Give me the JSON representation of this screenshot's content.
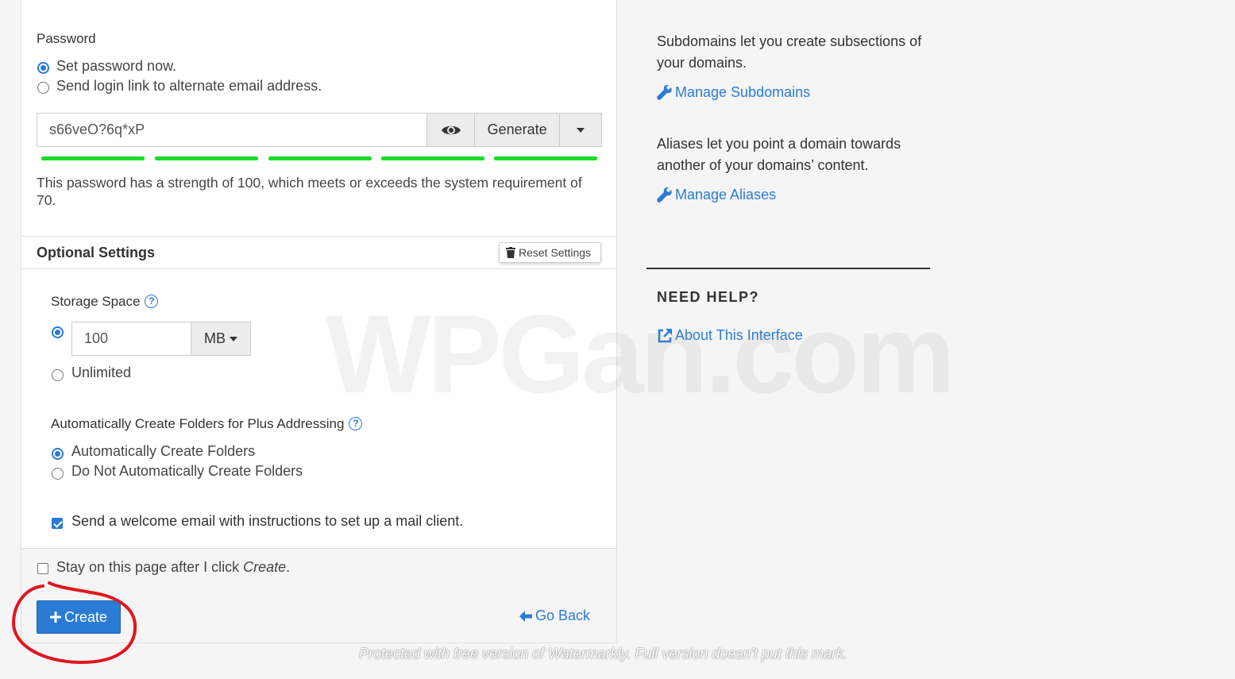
{
  "password": {
    "label": "Password",
    "options": [
      "Set password now.",
      "Send login link to alternate email address."
    ],
    "value": "s66veO?6q*xP",
    "generate_label": "Generate",
    "strength_segments": 5,
    "strength_text": "This password has a strength of 100, which meets or exceeds the system requirement of 70."
  },
  "optional_settings": {
    "title": "Optional Settings",
    "reset_label": "Reset Settings",
    "storage": {
      "label": "Storage Space",
      "value": "100",
      "unit": "MB",
      "unlimited_label": "Unlimited"
    },
    "plus_addressing": {
      "label": "Automatically Create Folders for Plus Addressing",
      "options": [
        "Automatically Create Folders",
        "Do Not Automatically Create Folders"
      ]
    },
    "welcome_email_label": "Send a welcome email with instructions to set up a mail client."
  },
  "footer": {
    "stay_prefix": "Stay on this page after I click ",
    "stay_emphasis": "Create",
    "stay_suffix": ".",
    "create_label": "Create",
    "go_back_label": "Go Back"
  },
  "sidebar": {
    "subdomains_text": "Subdomains let you create subsections of your domains.",
    "manage_subdomains": "Manage Subdomains",
    "aliases_text": "Aliases let you point a domain towards another of your domains’ content.",
    "manage_aliases": "Manage Aliases",
    "need_help": "NEED HELP?",
    "about_interface": "About This Interface"
  },
  "watermarks": {
    "big": "WPGan.com",
    "small": "Protected with free version of Watermarkly. Full version doesn't put this mark."
  },
  "colors": {
    "accent": "#2a7bd4",
    "strength": "#1ddc2a",
    "annotation": "#e0161e"
  }
}
